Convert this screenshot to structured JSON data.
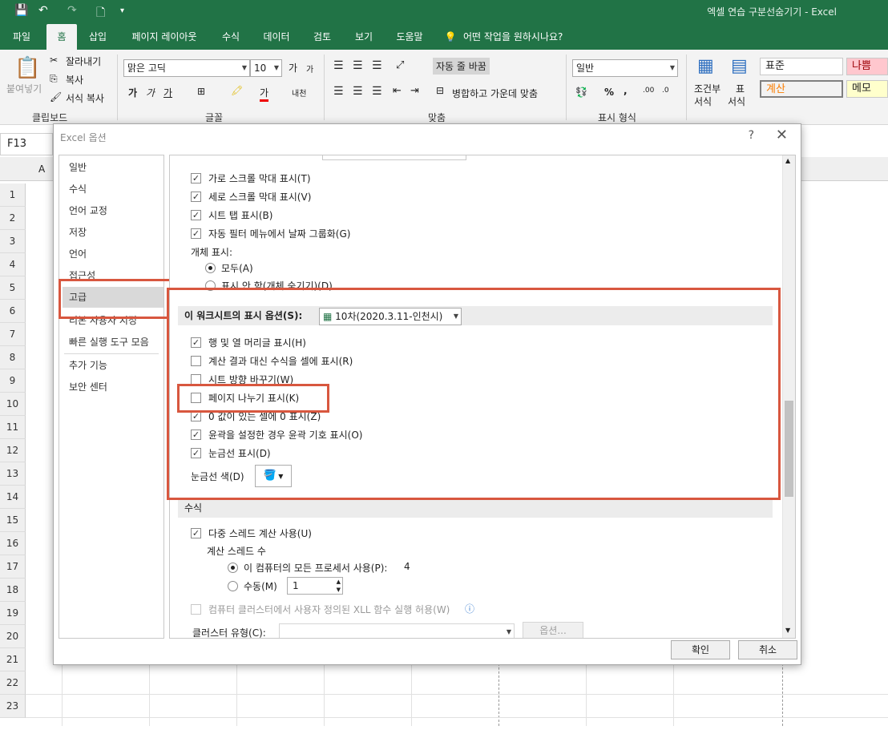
{
  "window": {
    "title": "엑셀 연습 구분선숨기기  -  Excel",
    "qat": [
      "save-icon",
      "undo-icon",
      "redo-icon",
      "print-preview-icon",
      "customize-icon"
    ]
  },
  "tabs": [
    "파일",
    "홈",
    "삽입",
    "페이지 레이아웃",
    "수식",
    "데이터",
    "검토",
    "보기",
    "도움말"
  ],
  "tell_me": "어떤 작업을 원하시나요?",
  "ribbon": {
    "clipboard": {
      "paste": "붙여넣기",
      "cut": "잘라내기",
      "copy": "복사",
      "format_painter": "서식 복사",
      "label": "클립보드"
    },
    "font": {
      "name": "맑은 고딕",
      "size": "10",
      "grow": "가",
      "shrink": "가",
      "bold": "가",
      "italic": "가",
      "underline": "가",
      "color": "가",
      "phonetic": "내천",
      "label": "글꼴"
    },
    "alignment": {
      "wrap": "자동 줄 바꿈",
      "merge": "병합하고 가운데 맞춤",
      "label": "맞춤"
    },
    "number": {
      "format": "일반",
      "percent": "%",
      "comma": ",",
      "label": "표시 형식"
    },
    "styles": {
      "conditional": "조건부",
      "conditional2": "서식",
      "table": "표",
      "table2": "서식",
      "normal": "표준",
      "bad": "나쁨",
      "calc": "계산",
      "memo": "메모"
    }
  },
  "namebox": "F13",
  "grid": {
    "col_a": "A",
    "rows": [
      "1",
      "2",
      "3",
      "4",
      "5",
      "6",
      "7",
      "8",
      "9",
      "10",
      "11",
      "12",
      "13",
      "14",
      "15",
      "16",
      "17",
      "18",
      "19",
      "20",
      "21",
      "22",
      "23"
    ]
  },
  "dialog": {
    "title": "Excel 옵션",
    "help": "?",
    "close": "✕",
    "nav": [
      "일반",
      "수식",
      "언어 교정",
      "저장",
      "언어",
      "접근성",
      "고급",
      "리본 사용자 지정",
      "빠른 실행 도구 모음",
      "추가 기능",
      "보안 센터"
    ],
    "workbook_opts": [
      {
        "label": "가로 스크롤 막대 표시(T)",
        "checked": true
      },
      {
        "label": "세로 스크롤 막대 표시(V)",
        "checked": true
      },
      {
        "label": "시트 탭 표시(B)",
        "checked": true
      },
      {
        "label": "자동 필터 메뉴에서 날짜 그룹화(G)",
        "checked": true
      }
    ],
    "objects_label": "개체 표시:",
    "objects_opts": [
      "모두(A)",
      "표시 안 함(개체 숨기기)(D)"
    ],
    "sheet_section": "이 워크시트의 표시 옵션(S):",
    "sheet_select": "10차(2020.3.11-인천시)",
    "sheet_opts": [
      {
        "label": "행 및 열 머리글 표시(H)",
        "checked": true
      },
      {
        "label": "계산 결과 대신 수식을 셀에 표시(R)",
        "checked": false
      },
      {
        "label": "시트 방향 바꾸기(W)",
        "checked": false
      },
      {
        "label": "페이지 나누기 표시(K)",
        "checked": false
      },
      {
        "label": "0 값이 있는 셀에 0 표시(Z)",
        "checked": true
      },
      {
        "label": "윤곽을 설정한 경우 윤곽 기호 표시(O)",
        "checked": true
      },
      {
        "label": "눈금선 표시(D)",
        "checked": true
      }
    ],
    "gridline_color": "눈금선 색(D)",
    "formula_section": "수식",
    "multithread": "다중 스레드 계산 사용(U)",
    "threads_label": "계산 스레드 수",
    "threads_all": "이 컴퓨터의 모든 프로세서 사용(P):",
    "threads_count": "4",
    "threads_manual": "수동(M)",
    "threads_manual_value": "1",
    "xll": "컴퓨터 클러스터에서 사용자 정의된 XLL 함수 실행 허용(W)",
    "cluster_type": "클러스터 유형(C):",
    "cluster_options": "옵션...",
    "ok": "확인",
    "cancel": "취소"
  },
  "colors": {
    "excel_green": "#217346",
    "highlight_red": "#d8573f",
    "bad_style_bg": "#ffc7ce",
    "bad_style_fg": "#9c0006",
    "calc_style_fg": "#fa7d00",
    "memo_bg": "#ffffcc"
  }
}
